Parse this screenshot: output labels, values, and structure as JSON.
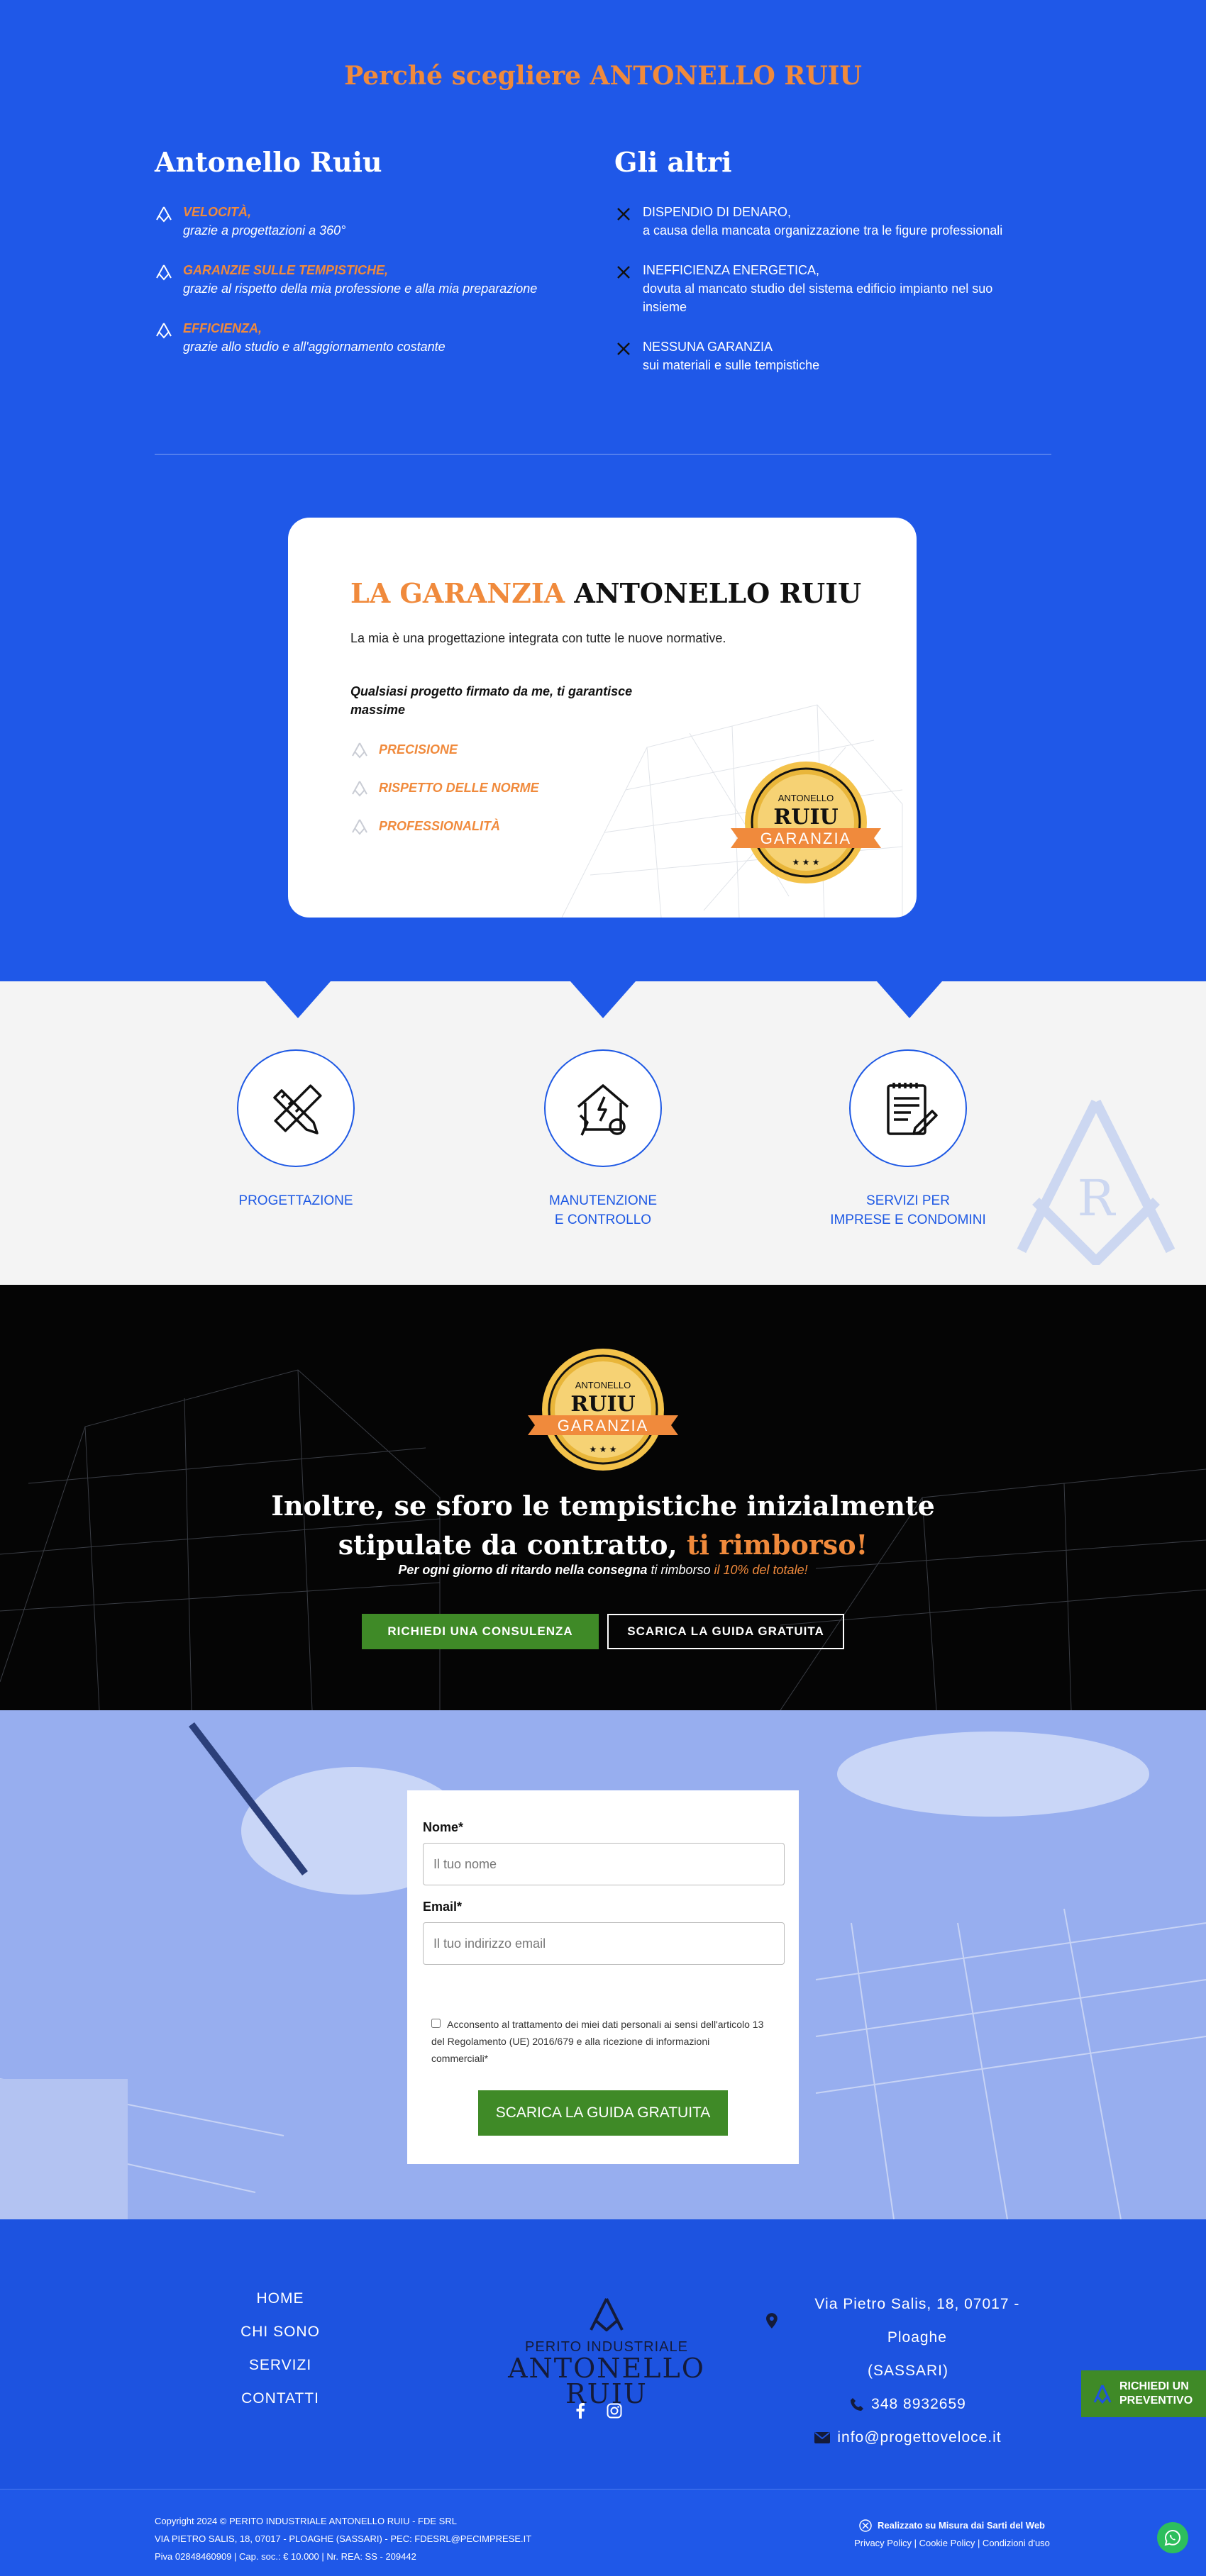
{
  "why": {
    "title": "Perché scegliere ANTONELLO RUIU",
    "pros_title": "Antonello Ruiu",
    "pros": [
      {
        "t1": "VELOCITÀ,",
        "t2": "grazie a progettazioni a 360°"
      },
      {
        "t1": "GARANZIE SULLE TEMPISTICHE,",
        "t2": "grazie al rispetto della mia professione e alla mia preparazione"
      },
      {
        "t1": "EFFICIENZA,",
        "t2": "grazie allo studio e all'aggiornamento costante"
      }
    ],
    "cons_title": "Gli altri",
    "cons": [
      {
        "t1": "DISPENDIO DI DENARO,",
        "t2": "a causa della mancata organizzazione tra le figure professionali"
      },
      {
        "t1": "INEFFICIENZA ENERGETICA,",
        "t2": "dovuta al mancato studio del sistema edificio impianto nel suo insieme"
      },
      {
        "t1": "NESSUNA GARANZIA",
        "t2": "sui materiali e sulle tempistiche"
      }
    ]
  },
  "guarantee": {
    "title_accent": "LA GARANZIA",
    "title_rest": "ANTONELLO RUIU",
    "intro": "La mia è una progettazione integrata con tutte le nuove normative.",
    "lead": "Qualsiasi progetto firmato da me, ti garantisce massime",
    "items": [
      "PRECISIONE",
      "RISPETTO DELLE NORME",
      "PROFESSIONALITÀ"
    ]
  },
  "badge": {
    "top": "ANTONELLO",
    "mid": "RUIU",
    "ribbon": "GARANZIA"
  },
  "services": [
    {
      "icon": "ruler-pencil-icon",
      "label_l1": "PROGETTAZIONE",
      "label_l2": ""
    },
    {
      "icon": "house-tools-icon",
      "label_l1": "MANUTENZIONE",
      "label_l2": "E CONTROLLO"
    },
    {
      "icon": "clipboard-icon",
      "label_l1": "SERVIZI PER",
      "label_l2": "IMPRESE E CONDOMINI"
    }
  ],
  "promise": {
    "title_l1": "Inoltre, se sforo le tempistiche inizialmente",
    "title_l2": "stipulate da contratto,",
    "title_accent": "ti rimborso!",
    "sub_bold": "Per ogni giorno di ritardo nella consegna",
    "sub_mid": "ti rimborso",
    "sub_accent": "il 10% del totale!",
    "btn_primary": "RICHIEDI UNA CONSULENZA",
    "btn_secondary": "SCARICA LA GUIDA GRATUITA"
  },
  "form": {
    "name_label": "Nome*",
    "name_placeholder": "Il tuo nome",
    "email_label": "Email*",
    "email_placeholder": "Il tuo indirizzo email",
    "consent": "Acconsento al trattamento dei miei dati personali ai sensi dell'articolo 13 del Regolamento (UE) 2016/679 e alla ricezione di informazioni commerciali*",
    "submit": "SCARICA LA GUIDA GRATUITA"
  },
  "footer": {
    "nav": [
      "HOME",
      "CHI SONO",
      "SERVIZI",
      "CONTATTI"
    ],
    "logo_l1": "PERITO INDUSTRIALE",
    "logo_l2": "ANTONELLO RUIU",
    "address_l1": "Via Pietro Salis, 18, 07017 - Ploaghe",
    "address_l2": "(SASSARI)",
    "phone": "348 8932659",
    "email": "info@progettoveloce.it",
    "float_cta_l1": "RICHIEDI UN",
    "float_cta_l2": "PREVENTIVO"
  },
  "bottombar": {
    "copy_l1": "Copyright 2024 © PERITO INDUSTRIALE ANTONELLO RUIU - FDE SRL",
    "copy_l2": "VIA PIETRO SALIS, 18, 07017 - PLOAGHE (SASSARI) - PEC: FDESRL@PECIMPRESE.IT",
    "copy_l3": "Piva 02848460909 | Cap. soc.: € 10.000 | Nr. REA: SS - 209442",
    "credit": "Realizzato su Misura dai Sarti del Web",
    "legal": "Privacy Policy | Cookie Policy | Condizioni d'uso"
  },
  "colors": {
    "blue": "#1f58e8",
    "orange": "#f08a3c",
    "green": "#3f8a27",
    "black": "#050505"
  }
}
